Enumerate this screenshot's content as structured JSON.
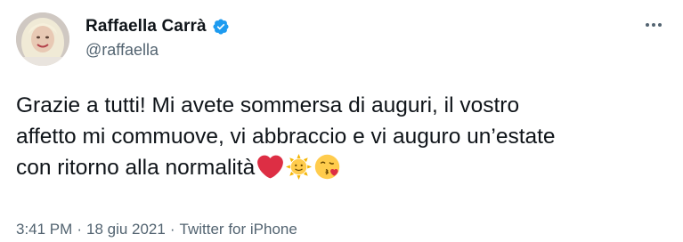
{
  "user": {
    "display_name": "Raffaella Carrà",
    "handle": "@raffaella",
    "verified_icon": "verified-badge-icon",
    "verified_color": "#1d9bf0"
  },
  "tweet": {
    "lines": [
      "Grazie a tutti! Mi avete sommersa di auguri, il vostro",
      "affetto mi commuove, vi abbraccio e vi auguro un’estate",
      "con ritorno alla normalità"
    ],
    "emojis": [
      "red-heart-icon",
      "sun-with-face-icon",
      "face-blowing-kiss-icon"
    ]
  },
  "meta": {
    "time": "3:41 PM",
    "date": "18 giu 2021",
    "source": "Twitter for iPhone",
    "separator": "·"
  },
  "colors": {
    "text": "#0f1419",
    "secondary": "#536471",
    "background": "#ffffff"
  }
}
